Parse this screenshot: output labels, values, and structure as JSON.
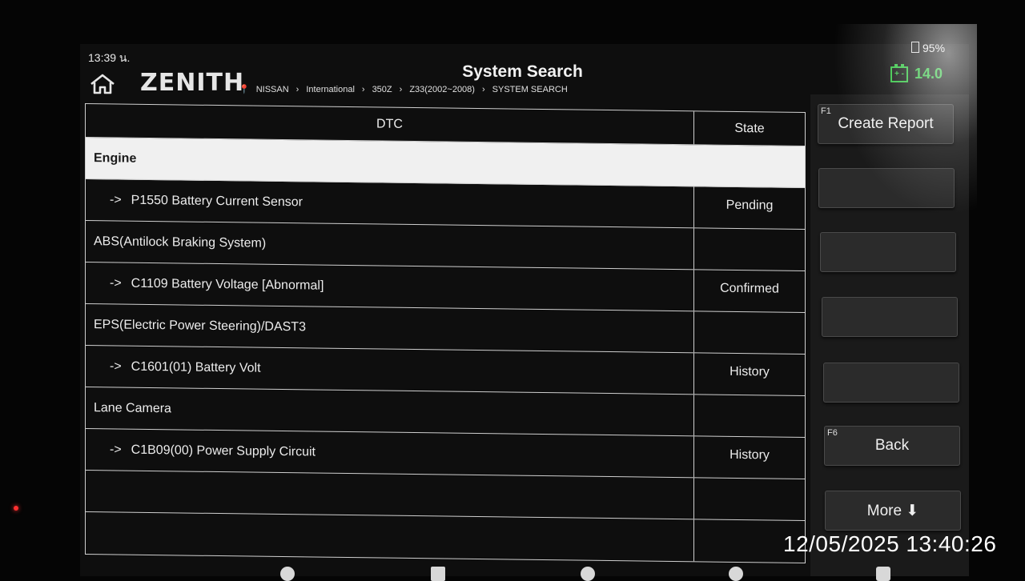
{
  "status": {
    "time": "13:39 น.",
    "battery": "95%"
  },
  "header": {
    "logo": "ZENITH",
    "title": "System Search",
    "breadcrumb": [
      "NISSAN",
      "International",
      "350Z",
      "Z33(2002~2008)",
      "SYSTEM SEARCH"
    ],
    "voltage": "14.0",
    "voltage_color": "#2fc23f"
  },
  "table": {
    "columns": {
      "dtc": "DTC",
      "state": "State"
    },
    "rows": [
      {
        "type": "system",
        "dtc": "Engine",
        "state": ""
      },
      {
        "type": "code",
        "arrow": "->",
        "dtc": "P1550 Battery Current Sensor",
        "state": "Pending"
      },
      {
        "type": "system",
        "dtc": "ABS(Antilock Braking System)",
        "state": ""
      },
      {
        "type": "code",
        "arrow": "->",
        "dtc": "C1109 Battery Voltage [Abnormal]",
        "state": "Confirmed"
      },
      {
        "type": "system",
        "dtc": "EPS(Electric Power Steering)/DAST3",
        "state": ""
      },
      {
        "type": "code",
        "arrow": "->",
        "dtc": "C1601(01) Battery Volt",
        "state": "History"
      },
      {
        "type": "system",
        "dtc": "Lane Camera",
        "state": ""
      },
      {
        "type": "code",
        "arrow": "->",
        "dtc": "C1B09(00) Power Supply Circuit",
        "state": "History"
      },
      {
        "type": "empty",
        "dtc": "",
        "state": ""
      },
      {
        "type": "empty",
        "dtc": "",
        "state": ""
      }
    ]
  },
  "buttons": {
    "create_report": {
      "key": "F1",
      "label": "Create Report"
    },
    "back": {
      "key": "F6",
      "label": "Back"
    },
    "more": {
      "label": "More ⬇"
    }
  },
  "timestamp": "12/05/2025 13:40:26"
}
